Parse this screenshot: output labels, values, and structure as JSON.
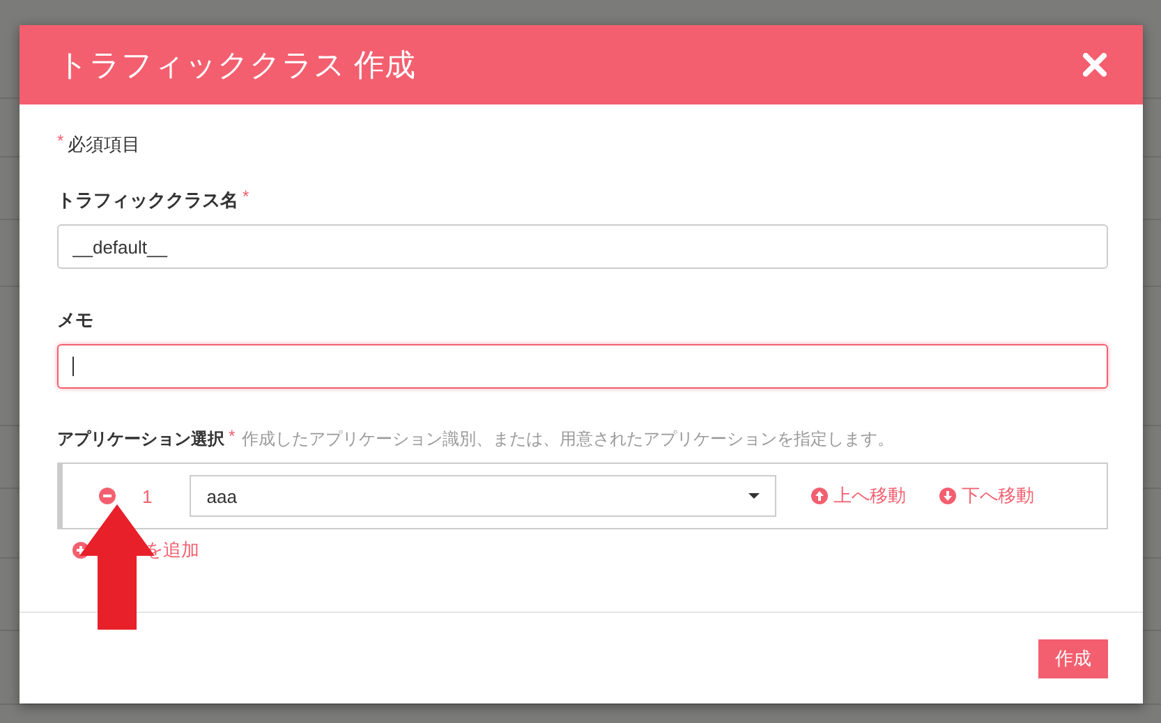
{
  "dialog": {
    "title": "トラフィッククラス 作成",
    "required_mark": "*",
    "required_note": "必須項目",
    "fields": [
      {
        "label": "トラフィッククラス名",
        "required_mark": "*",
        "value": "__default__",
        "focused": false
      },
      {
        "label": "メモ",
        "focused": true
      }
    ],
    "applications": {
      "label": "アプリケーション選択",
      "required_mark": "*",
      "description": "作成したアプリケーション識別、または、用意されたアプリケーションを指定します。",
      "rows": [
        {
          "index": "1",
          "value": "aaa",
          "move_up": "上へ移動",
          "move_down": "下へ移動"
        }
      ],
      "add_link": "を追加"
    },
    "submit": "作成"
  }
}
